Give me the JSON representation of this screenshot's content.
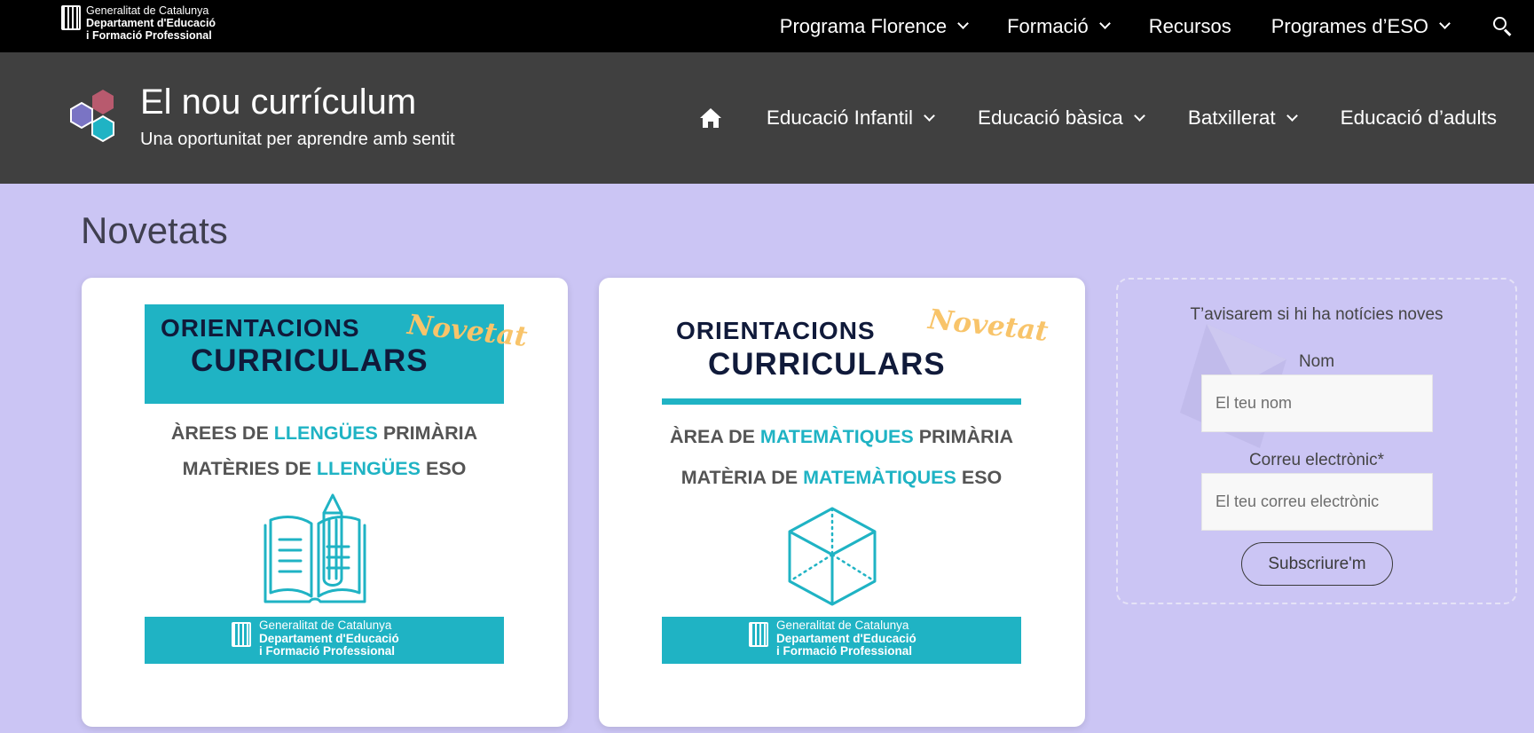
{
  "topbar": {
    "gencat": {
      "line1": "Generalitat de Catalunya",
      "line2": "Departament d'Educació",
      "line3": "i Formació Professional"
    },
    "nav": [
      {
        "label": "Programa Florence",
        "dropdown": true
      },
      {
        "label": "Formació",
        "dropdown": true
      },
      {
        "label": "Recursos",
        "dropdown": false
      },
      {
        "label": "Programes d’ESO",
        "dropdown": true
      }
    ],
    "search_icon": "search-icon"
  },
  "header": {
    "title": "El nou currículum",
    "tagline": "Una oportunitat per aprendre amb sentit",
    "logo_colors": [
      "#b85a6e",
      "#7a74c4",
      "#1fb3c4"
    ],
    "nav": [
      {
        "label": "Educació Infantil",
        "dropdown": true
      },
      {
        "label": "Educació bàsica",
        "dropdown": true
      },
      {
        "label": "Batxillerat",
        "dropdown": true
      },
      {
        "label": "Educació d’adults",
        "dropdown": false
      }
    ]
  },
  "main": {
    "title": "Novetats",
    "cards": [
      {
        "title1": "ORIENTACIONS",
        "title2": "CURRICULARS",
        "badge": "Novetat",
        "line1_pre": "ÀREES DE ",
        "line1_hl": "LLENGÜES",
        "line1_post": " PRIMÀRIA",
        "line2_pre": "MATÈRIES DE ",
        "line2_hl": "LLENGÜES",
        "line2_post": " ESO",
        "icon": "book-pencil-icon",
        "footer1": "Generalitat de Catalunya",
        "footer2": "Departament d'Educació",
        "footer3": "i Formació Professional"
      },
      {
        "title1": "ORIENTACIONS",
        "title2": "CURRICULARS",
        "badge": "Novetat",
        "line1_pre": "ÀREA DE ",
        "line1_hl": "MATEMÀTIQUES",
        "line1_post": "  PRIMÀRIA",
        "line2_pre": "MATÈRIA DE ",
        "line2_hl": "MATEMÀTIQUES",
        "line2_post": " ESO",
        "icon": "cube-icon",
        "footer1": "Generalitat de Catalunya",
        "footer2": "Departament d'Educació",
        "footer3": "i Formació Professional"
      }
    ]
  },
  "subscribe": {
    "title": "T’avisarem si hi ha notícies noves",
    "name_label": "Nom",
    "name_placeholder": "El teu nom",
    "email_label": "Correu electrònic*",
    "email_placeholder": "El teu correu electrònic",
    "button": "Subscriure'm"
  },
  "colors": {
    "accent": "#1fb3c4",
    "navy": "#101a3a",
    "badge": "#f8c46a",
    "background": "#cbc5f4",
    "header": "#404040"
  }
}
